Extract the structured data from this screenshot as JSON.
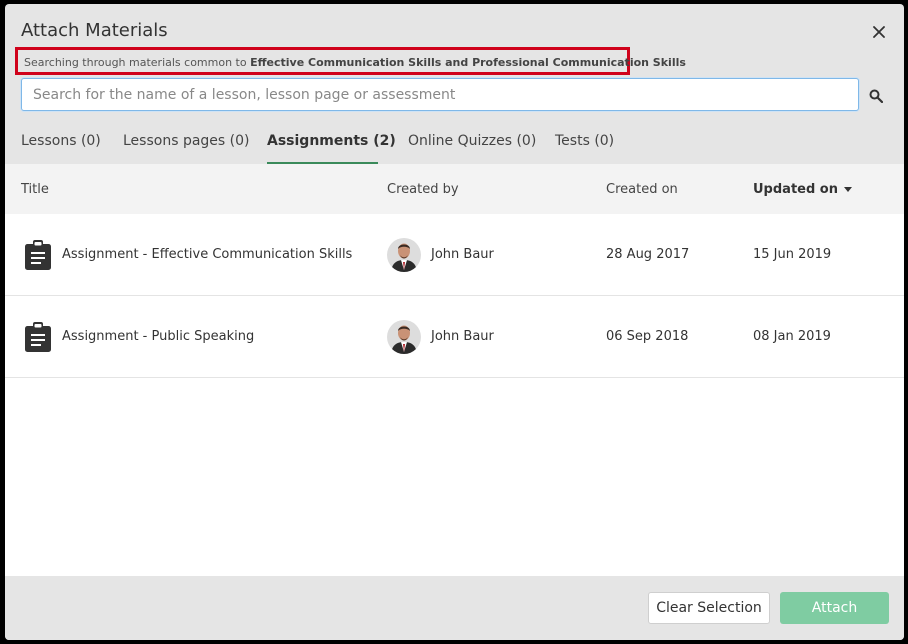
{
  "dialog": {
    "title": "Attach Materials",
    "close_icon": "close-icon"
  },
  "notice": {
    "prefix": "Searching through materials common to ",
    "courses": "Effective Communication Skills and Professional Communication Skills"
  },
  "search": {
    "value": "",
    "placeholder": "Search for the name of a lesson, lesson page or assessment",
    "icon": "search-icon"
  },
  "tabs": [
    {
      "label": "Lessons (0)",
      "active": false
    },
    {
      "label": "Lessons pages (0)",
      "active": false
    },
    {
      "label": "Assignments (2)",
      "active": true
    },
    {
      "label": "Online Quizzes (0)",
      "active": false
    },
    {
      "label": "Tests (0)",
      "active": false
    }
  ],
  "table": {
    "columns": [
      "Title",
      "Created by",
      "Created on",
      "Updated on"
    ],
    "sorted_column": "Updated on",
    "sort_icon": "caret-down-icon",
    "rows": [
      {
        "icon": "clipboard-icon",
        "title": "Assignment - Effective Communication Skills",
        "created_by": "John Baur",
        "created_on": "28 Aug 2017",
        "updated_on": "15 Jun 2019"
      },
      {
        "icon": "clipboard-icon",
        "title": "Assignment - Public Speaking",
        "created_by": "John Baur",
        "created_on": "06 Sep 2018",
        "updated_on": "08 Jan 2019"
      }
    ]
  },
  "footer": {
    "clear_label": "Clear Selection",
    "attach_label": "Attach"
  },
  "colors": {
    "accent": "#3a8a5a",
    "attach_button": "#7fcca2",
    "highlight_border": "#d0021b"
  }
}
